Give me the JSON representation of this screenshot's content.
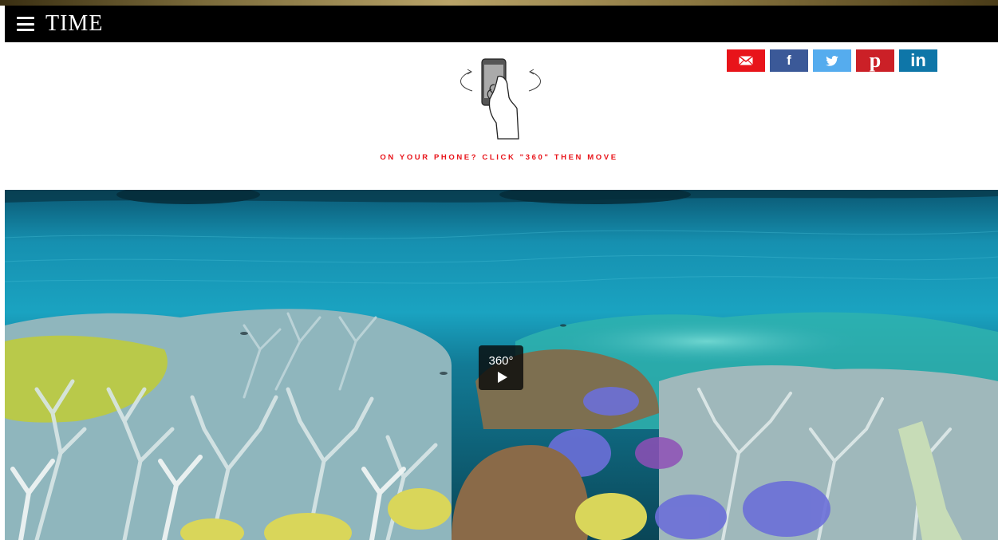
{
  "header": {
    "brand": "TIME",
    "menu_icon": "hamburger-menu-icon"
  },
  "share": {
    "items": [
      {
        "name": "email",
        "icon": "email-icon",
        "label": "",
        "color": "#e8141a"
      },
      {
        "name": "facebook",
        "icon": "facebook-icon",
        "label": "f",
        "color": "#3b5998"
      },
      {
        "name": "twitter",
        "icon": "twitter-icon",
        "label": "",
        "color": "#55acee"
      },
      {
        "name": "pinterest",
        "icon": "pinterest-icon",
        "label": "p",
        "color": "#cb2027"
      },
      {
        "name": "linkedin",
        "icon": "linkedin-icon",
        "label": "in",
        "color": "#0e76a8"
      }
    ]
  },
  "instruction": {
    "text": "ON YOUR PHONE? CLICK \"360\" THEN MOVE",
    "color": "#e8141a",
    "illustration": "phone-rotate-icon"
  },
  "panorama": {
    "play_label": "360°",
    "play_icon": "play-icon"
  }
}
